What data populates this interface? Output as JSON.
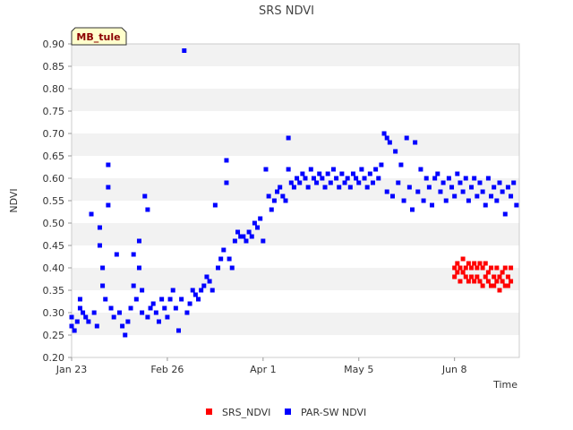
{
  "chart_data": {
    "type": "scatter",
    "title": "SRS NDVI",
    "xlabel": "Time",
    "ylabel": "NDVI",
    "site_badge": "MB_tule",
    "x_start": "2021-01-23",
    "x_end": "2021-07-01",
    "x_ticks": [
      {
        "date": "2021-01-23",
        "label": "Jan 23"
      },
      {
        "date": "2021-02-26",
        "label": "Feb 26"
      },
      {
        "date": "2021-04-01",
        "label": "Apr 1"
      },
      {
        "date": "2021-05-05",
        "label": "May 5"
      },
      {
        "date": "2021-06-08",
        "label": "Jun 8"
      }
    ],
    "ylim": [
      0.2,
      0.9
    ],
    "y_ticks": [
      "0.20",
      "0.25",
      "0.30",
      "0.35",
      "0.40",
      "0.45",
      "0.50",
      "0.55",
      "0.60",
      "0.65",
      "0.70",
      "0.75",
      "0.80",
      "0.85",
      "0.90"
    ],
    "grid": "alternating horizontal bands",
    "legend_position": "bottom",
    "series": [
      {
        "name": "SRS_NDVI",
        "color": "#ff0000",
        "points": [
          [
            "2021-06-08",
            0.4
          ],
          [
            "2021-06-08",
            0.38
          ],
          [
            "2021-06-09",
            0.41
          ],
          [
            "2021-06-09",
            0.39
          ],
          [
            "2021-06-10",
            0.4
          ],
          [
            "2021-06-10",
            0.37
          ],
          [
            "2021-06-11",
            0.42
          ],
          [
            "2021-06-11",
            0.39
          ],
          [
            "2021-06-12",
            0.4
          ],
          [
            "2021-06-12",
            0.38
          ],
          [
            "2021-06-13",
            0.41
          ],
          [
            "2021-06-13",
            0.37
          ],
          [
            "2021-06-14",
            0.4
          ],
          [
            "2021-06-14",
            0.38
          ],
          [
            "2021-06-15",
            0.41
          ],
          [
            "2021-06-15",
            0.37
          ],
          [
            "2021-06-16",
            0.4
          ],
          [
            "2021-06-16",
            0.38
          ],
          [
            "2021-06-17",
            0.41
          ],
          [
            "2021-06-17",
            0.37
          ],
          [
            "2021-06-18",
            0.4
          ],
          [
            "2021-06-18",
            0.36
          ],
          [
            "2021-06-19",
            0.41
          ],
          [
            "2021-06-19",
            0.38
          ],
          [
            "2021-06-20",
            0.39
          ],
          [
            "2021-06-20",
            0.37
          ],
          [
            "2021-06-21",
            0.4
          ],
          [
            "2021-06-21",
            0.36
          ],
          [
            "2021-06-22",
            0.38
          ],
          [
            "2021-06-22",
            0.36
          ],
          [
            "2021-06-23",
            0.4
          ],
          [
            "2021-06-23",
            0.37
          ],
          [
            "2021-06-24",
            0.38
          ],
          [
            "2021-06-24",
            0.35
          ],
          [
            "2021-06-25",
            0.39
          ],
          [
            "2021-06-25",
            0.37
          ],
          [
            "2021-06-26",
            0.4
          ],
          [
            "2021-06-26",
            0.36
          ],
          [
            "2021-06-27",
            0.38
          ],
          [
            "2021-06-27",
            0.36
          ],
          [
            "2021-06-28",
            0.4
          ],
          [
            "2021-06-28",
            0.37
          ]
        ]
      },
      {
        "name": "PAR-SW NDVI",
        "color": "#0000ff",
        "points": [
          [
            "2021-01-23",
            0.27
          ],
          [
            "2021-01-23",
            0.29
          ],
          [
            "2021-01-24",
            0.26
          ],
          [
            "2021-01-25",
            0.28
          ],
          [
            "2021-01-26",
            0.31
          ],
          [
            "2021-01-26",
            0.33
          ],
          [
            "2021-01-27",
            0.3
          ],
          [
            "2021-01-28",
            0.29
          ],
          [
            "2021-01-29",
            0.28
          ],
          [
            "2021-01-30",
            0.52
          ],
          [
            "2021-01-31",
            0.3
          ],
          [
            "2021-02-01",
            0.27
          ],
          [
            "2021-02-02",
            0.49
          ],
          [
            "2021-02-02",
            0.45
          ],
          [
            "2021-02-03",
            0.4
          ],
          [
            "2021-02-03",
            0.36
          ],
          [
            "2021-02-04",
            0.33
          ],
          [
            "2021-02-05",
            0.63
          ],
          [
            "2021-02-05",
            0.58
          ],
          [
            "2021-02-05",
            0.54
          ],
          [
            "2021-02-06",
            0.31
          ],
          [
            "2021-02-07",
            0.29
          ],
          [
            "2021-02-08",
            0.43
          ],
          [
            "2021-02-09",
            0.3
          ],
          [
            "2021-02-10",
            0.27
          ],
          [
            "2021-02-11",
            0.25
          ],
          [
            "2021-02-12",
            0.28
          ],
          [
            "2021-02-13",
            0.31
          ],
          [
            "2021-02-14",
            0.43
          ],
          [
            "2021-02-14",
            0.36
          ],
          [
            "2021-02-15",
            0.33
          ],
          [
            "2021-02-16",
            0.46
          ],
          [
            "2021-02-16",
            0.4
          ],
          [
            "2021-02-17",
            0.35
          ],
          [
            "2021-02-17",
            0.3
          ],
          [
            "2021-02-18",
            0.56
          ],
          [
            "2021-02-19",
            0.53
          ],
          [
            "2021-02-19",
            0.29
          ],
          [
            "2021-02-20",
            0.31
          ],
          [
            "2021-02-21",
            0.32
          ],
          [
            "2021-02-22",
            0.3
          ],
          [
            "2021-02-23",
            0.28
          ],
          [
            "2021-02-24",
            0.33
          ],
          [
            "2021-02-25",
            0.31
          ],
          [
            "2021-02-26",
            0.29
          ],
          [
            "2021-02-27",
            0.33
          ],
          [
            "2021-02-28",
            0.35
          ],
          [
            "2021-03-01",
            0.31
          ],
          [
            "2021-03-02",
            0.26
          ],
          [
            "2021-03-03",
            0.33
          ],
          [
            "2021-03-04",
            0.885
          ],
          [
            "2021-03-05",
            0.3
          ],
          [
            "2021-03-06",
            0.32
          ],
          [
            "2021-03-07",
            0.35
          ],
          [
            "2021-03-08",
            0.34
          ],
          [
            "2021-03-09",
            0.33
          ],
          [
            "2021-03-10",
            0.35
          ],
          [
            "2021-03-11",
            0.36
          ],
          [
            "2021-03-12",
            0.38
          ],
          [
            "2021-03-13",
            0.37
          ],
          [
            "2021-03-14",
            0.35
          ],
          [
            "2021-03-15",
            0.54
          ],
          [
            "2021-03-16",
            0.4
          ],
          [
            "2021-03-17",
            0.42
          ],
          [
            "2021-03-18",
            0.44
          ],
          [
            "2021-03-19",
            0.64
          ],
          [
            "2021-03-19",
            0.59
          ],
          [
            "2021-03-20",
            0.42
          ],
          [
            "2021-03-21",
            0.4
          ],
          [
            "2021-03-22",
            0.46
          ],
          [
            "2021-03-23",
            0.48
          ],
          [
            "2021-03-24",
            0.47
          ],
          [
            "2021-03-25",
            0.47
          ],
          [
            "2021-03-26",
            0.46
          ],
          [
            "2021-03-27",
            0.48
          ],
          [
            "2021-03-28",
            0.47
          ],
          [
            "2021-03-29",
            0.5
          ],
          [
            "2021-03-30",
            0.49
          ],
          [
            "2021-03-31",
            0.51
          ],
          [
            "2021-04-01",
            0.46
          ],
          [
            "2021-04-02",
            0.62
          ],
          [
            "2021-04-03",
            0.56
          ],
          [
            "2021-04-04",
            0.53
          ],
          [
            "2021-04-05",
            0.55
          ],
          [
            "2021-04-06",
            0.57
          ],
          [
            "2021-04-07",
            0.58
          ],
          [
            "2021-04-08",
            0.56
          ],
          [
            "2021-04-09",
            0.55
          ],
          [
            "2021-04-10",
            0.69
          ],
          [
            "2021-04-10",
            0.62
          ],
          [
            "2021-04-11",
            0.59
          ],
          [
            "2021-04-12",
            0.58
          ],
          [
            "2021-04-13",
            0.6
          ],
          [
            "2021-04-14",
            0.59
          ],
          [
            "2021-04-15",
            0.61
          ],
          [
            "2021-04-16",
            0.6
          ],
          [
            "2021-04-17",
            0.58
          ],
          [
            "2021-04-18",
            0.62
          ],
          [
            "2021-04-19",
            0.6
          ],
          [
            "2021-04-20",
            0.59
          ],
          [
            "2021-04-21",
            0.61
          ],
          [
            "2021-04-22",
            0.6
          ],
          [
            "2021-04-23",
            0.58
          ],
          [
            "2021-04-24",
            0.61
          ],
          [
            "2021-04-25",
            0.59
          ],
          [
            "2021-04-26",
            0.62
          ],
          [
            "2021-04-27",
            0.6
          ],
          [
            "2021-04-28",
            0.58
          ],
          [
            "2021-04-29",
            0.61
          ],
          [
            "2021-04-30",
            0.59
          ],
          [
            "2021-05-01",
            0.6
          ],
          [
            "2021-05-02",
            0.58
          ],
          [
            "2021-05-03",
            0.61
          ],
          [
            "2021-05-04",
            0.6
          ],
          [
            "2021-05-05",
            0.59
          ],
          [
            "2021-05-06",
            0.62
          ],
          [
            "2021-05-07",
            0.6
          ],
          [
            "2021-05-08",
            0.58
          ],
          [
            "2021-05-09",
            0.61
          ],
          [
            "2021-05-10",
            0.59
          ],
          [
            "2021-05-11",
            0.62
          ],
          [
            "2021-05-12",
            0.6
          ],
          [
            "2021-05-13",
            0.63
          ],
          [
            "2021-05-14",
            0.7
          ],
          [
            "2021-05-15",
            0.69
          ],
          [
            "2021-05-15",
            0.57
          ],
          [
            "2021-05-16",
            0.68
          ],
          [
            "2021-05-17",
            0.56
          ],
          [
            "2021-05-18",
            0.66
          ],
          [
            "2021-05-19",
            0.59
          ],
          [
            "2021-05-20",
            0.63
          ],
          [
            "2021-05-21",
            0.55
          ],
          [
            "2021-05-22",
            0.69
          ],
          [
            "2021-05-23",
            0.58
          ],
          [
            "2021-05-24",
            0.53
          ],
          [
            "2021-05-25",
            0.68
          ],
          [
            "2021-05-26",
            0.57
          ],
          [
            "2021-05-27",
            0.62
          ],
          [
            "2021-05-28",
            0.55
          ],
          [
            "2021-05-29",
            0.6
          ],
          [
            "2021-05-30",
            0.58
          ],
          [
            "2021-05-31",
            0.54
          ],
          [
            "2021-06-01",
            0.6
          ],
          [
            "2021-06-02",
            0.61
          ],
          [
            "2021-06-03",
            0.57
          ],
          [
            "2021-06-04",
            0.59
          ],
          [
            "2021-06-05",
            0.55
          ],
          [
            "2021-06-06",
            0.6
          ],
          [
            "2021-06-07",
            0.58
          ],
          [
            "2021-06-08",
            0.56
          ],
          [
            "2021-06-09",
            0.61
          ],
          [
            "2021-06-10",
            0.59
          ],
          [
            "2021-06-11",
            0.57
          ],
          [
            "2021-06-12",
            0.6
          ],
          [
            "2021-06-13",
            0.55
          ],
          [
            "2021-06-14",
            0.58
          ],
          [
            "2021-06-15",
            0.6
          ],
          [
            "2021-06-16",
            0.56
          ],
          [
            "2021-06-17",
            0.59
          ],
          [
            "2021-06-18",
            0.57
          ],
          [
            "2021-06-19",
            0.54
          ],
          [
            "2021-06-20",
            0.6
          ],
          [
            "2021-06-21",
            0.56
          ],
          [
            "2021-06-22",
            0.58
          ],
          [
            "2021-06-23",
            0.55
          ],
          [
            "2021-06-24",
            0.59
          ],
          [
            "2021-06-25",
            0.57
          ],
          [
            "2021-06-26",
            0.52
          ],
          [
            "2021-06-27",
            0.58
          ],
          [
            "2021-06-28",
            0.56
          ],
          [
            "2021-06-29",
            0.59
          ],
          [
            "2021-06-30",
            0.54
          ]
        ]
      }
    ]
  }
}
